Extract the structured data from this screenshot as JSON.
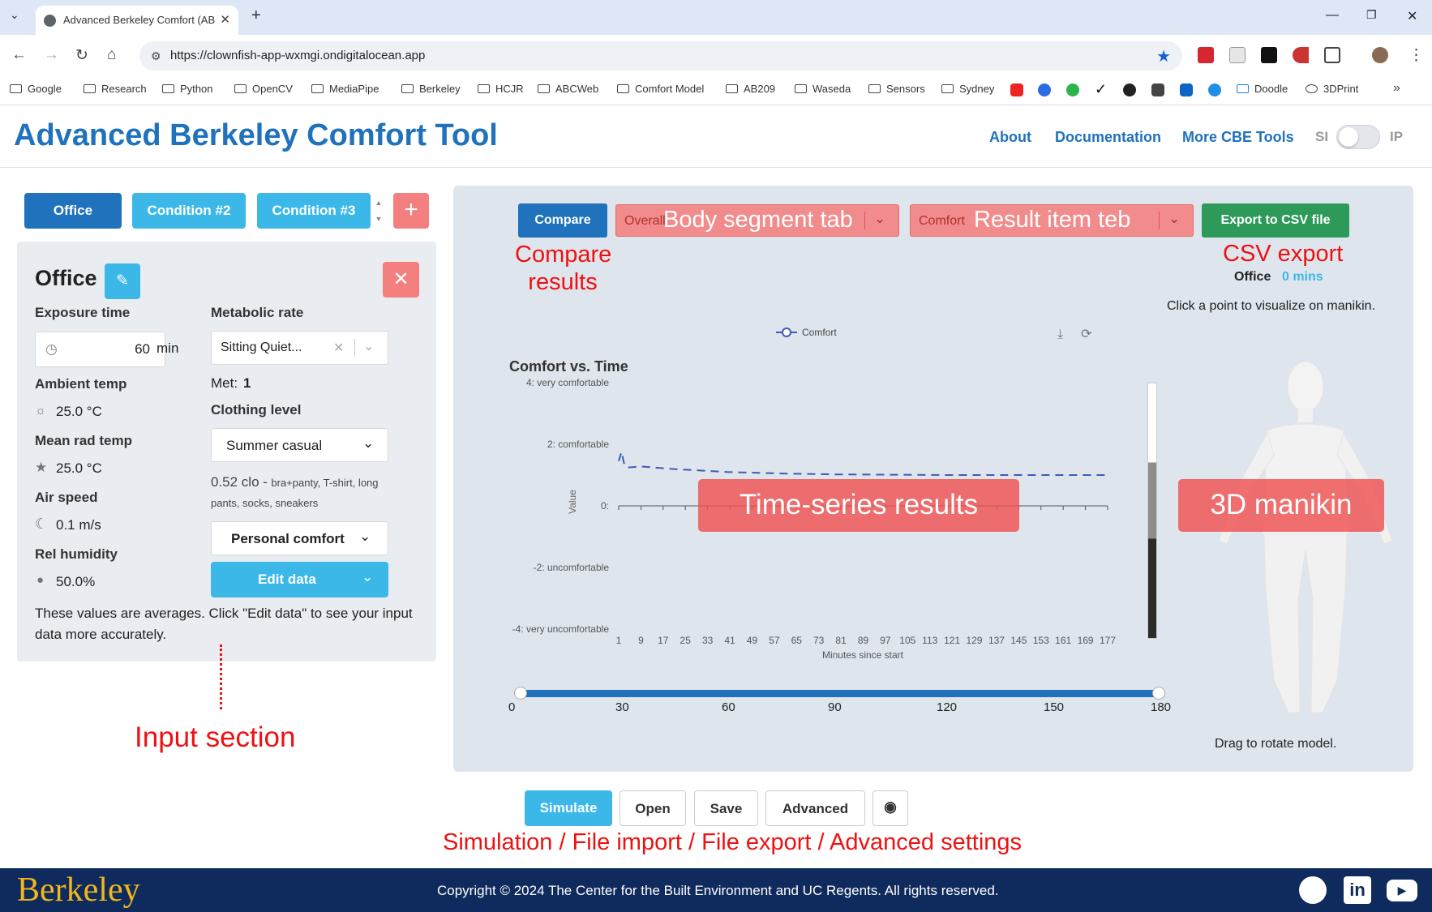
{
  "browser": {
    "tab_title": "Advanced Berkeley Comfort (AB",
    "url": "https://clownfish-app-wxmgi.ondigitalocean.app",
    "bookmarks": [
      "Google",
      "Research",
      "Python",
      "OpenCV",
      "MediaPipe",
      "Berkeley",
      "HCJR",
      "ABCWeb",
      "Comfort Model",
      "AB209",
      "Waseda",
      "Sensors",
      "Sydney",
      "Doodle",
      "3DPrint"
    ]
  },
  "header": {
    "title": "Advanced Berkeley Comfort Tool",
    "links": [
      "About",
      "Documentation",
      "More CBE Tools"
    ],
    "unit_si": "SI",
    "unit_ip": "IP"
  },
  "conditions": [
    "Office",
    "Condition #2",
    "Condition #3"
  ],
  "add_label": "+",
  "input": {
    "name": "Office",
    "exposure_label": "Exposure time",
    "exposure_value": "60",
    "exposure_unit": "min",
    "ambient_label": "Ambient temp",
    "ambient_value": "25.0 °C",
    "mrt_label": "Mean rad temp",
    "mrt_value": "25.0 °C",
    "air_label": "Air speed",
    "air_value": "0.1 m/s",
    "rh_label": "Rel humidity",
    "rh_value": "50.0%",
    "met_label": "Metabolic rate",
    "met_select": "Sitting Quiet...",
    "met_text": "Met:",
    "met_value": "1",
    "clo_label": "Clothing level",
    "clo_select": "Summer casual",
    "clo_value": "0.52 clo -",
    "clo_desc": "bra+panty, T-shirt, long pants, socks, sneakers",
    "personal": "Personal comfort",
    "edit": "Edit data",
    "note": "These values are averages. Click \"Edit data\" to see your input data more accurately."
  },
  "results": {
    "compare": "Compare",
    "segment_select": "Overall",
    "item_select": "Comfort",
    "export": "Export to CSV file",
    "cond_name": "Office",
    "cond_time": "0 mins",
    "hint": "Click a point to visualize on manikin.",
    "drag_hint": "Drag to rotate model."
  },
  "annotations": {
    "body_segment": "Body segment tab",
    "result_item": "Result item teb",
    "compare": "Compare results",
    "csv": "CSV export",
    "timeseries": "Time-series results",
    "manikin": "3D manikin",
    "input": "Input section",
    "bottom": "Simulation / File import / File export / Advanced  settings"
  },
  "chart_data": {
    "type": "line",
    "title": "Comfort vs. Time",
    "xlabel": "Minutes since start",
    "ylabel": "Value",
    "legend": "top-center",
    "ylim": [
      -4,
      4
    ],
    "y_ticks": [
      "4: very comfortable",
      "2: comfortable",
      "0:",
      "-2: uncomfortable",
      "-4: very uncomfortable"
    ],
    "x_ticks": [
      1,
      9,
      17,
      25,
      33,
      41,
      49,
      57,
      65,
      73,
      81,
      89,
      97,
      105,
      113,
      121,
      129,
      137,
      145,
      153,
      161,
      169,
      177
    ],
    "series": [
      {
        "name": "Comfort",
        "x": [
          1,
          2,
          3,
          4,
          5,
          9,
          20,
          40,
          60,
          80,
          100,
          120,
          140,
          160,
          177
        ],
        "values": [
          1.45,
          1.75,
          1.35,
          1.25,
          1.25,
          1.28,
          1.2,
          1.1,
          1.05,
          1.02,
          1.01,
          1.0,
          1.0,
          1.0,
          1.0
        ]
      }
    ]
  },
  "slider": {
    "min": 0,
    "max": 180,
    "value_start": 0,
    "value_end": 180,
    "ticks": [
      "0",
      "30",
      "60",
      "90",
      "120",
      "150",
      "180"
    ]
  },
  "bottom_buttons": [
    "Simulate",
    "Open",
    "Save",
    "Advanced"
  ],
  "footer": {
    "logo": "Berkeley",
    "copyright": "Copyright © 2024 The Center for the Built Environment and UC Regents. All rights reserved."
  },
  "colors": {
    "primary": "#1f72bb",
    "tab_active": "#1f72bb",
    "tab": "#3bb8e8",
    "export": "#2e9a5a",
    "danger": "#f37f7f",
    "footer": "#0f2a5c",
    "line": "#3d5bb7"
  }
}
